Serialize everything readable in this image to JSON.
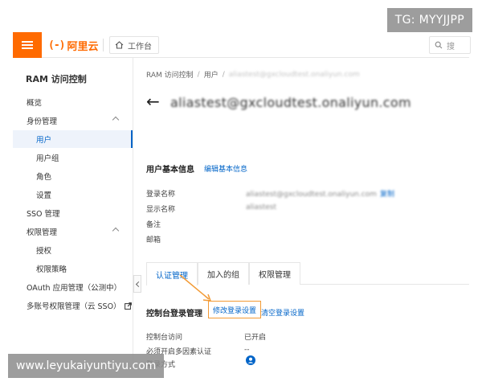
{
  "overlays": {
    "top_badge": "TG: MYYJJPP",
    "bottom_watermark": "www.leyukaiyuntiyu.com"
  },
  "topbar": {
    "logo_mark": "(-)",
    "logo_text": "阿里云",
    "workbench_label": "工作台",
    "search_placeholder": "搜",
    "accent_color": "#ff6a00"
  },
  "sidebar": {
    "title": "RAM 访问控制",
    "items": [
      {
        "label": "概览"
      },
      {
        "label": "身份管理"
      },
      {
        "label": "用户"
      },
      {
        "label": "用户组"
      },
      {
        "label": "角色"
      },
      {
        "label": "设置"
      },
      {
        "label": "SSO 管理"
      },
      {
        "label": "权限管理"
      },
      {
        "label": "授权"
      },
      {
        "label": "权限策略"
      },
      {
        "label": "OAuth 应用管理（公测中）"
      },
      {
        "label": "多账号权限管理（云 SSO）"
      }
    ],
    "active_color": "#0064c8"
  },
  "main": {
    "breadcrumb": [
      "RAM 访问控制",
      "用户",
      "aliastest@gxcloudtest.onaliyun.com"
    ],
    "page_title": "aliastest@gxcloudtest.onaliyun.com",
    "basic_info": {
      "title": "用户基本信息",
      "edit_link": "编辑基本信息",
      "rows": [
        {
          "label": "登录名称",
          "value": "aliastest@gxcloudtest.onaliyun.com",
          "copy": "复制"
        },
        {
          "label": "显示名称",
          "value": "aliastest"
        },
        {
          "label": "备注",
          "value": ""
        },
        {
          "label": "邮箱",
          "value": ""
        }
      ]
    },
    "tabs": [
      {
        "label": "认证管理",
        "active": true
      },
      {
        "label": "加入的组",
        "active": false
      },
      {
        "label": "权限管理",
        "active": false
      }
    ],
    "console_login": {
      "title": "控制台登录管理",
      "edit_link": "修改登录设置",
      "clear_link": "清空登录设置",
      "highlight_color": "#f29a35",
      "rows": [
        {
          "label": "控制台访问",
          "value": "已开启"
        },
        {
          "label": "必须开启多因素认证",
          "value": "--"
        },
        {
          "label": "登录方式",
          "value": ""
        }
      ]
    }
  }
}
